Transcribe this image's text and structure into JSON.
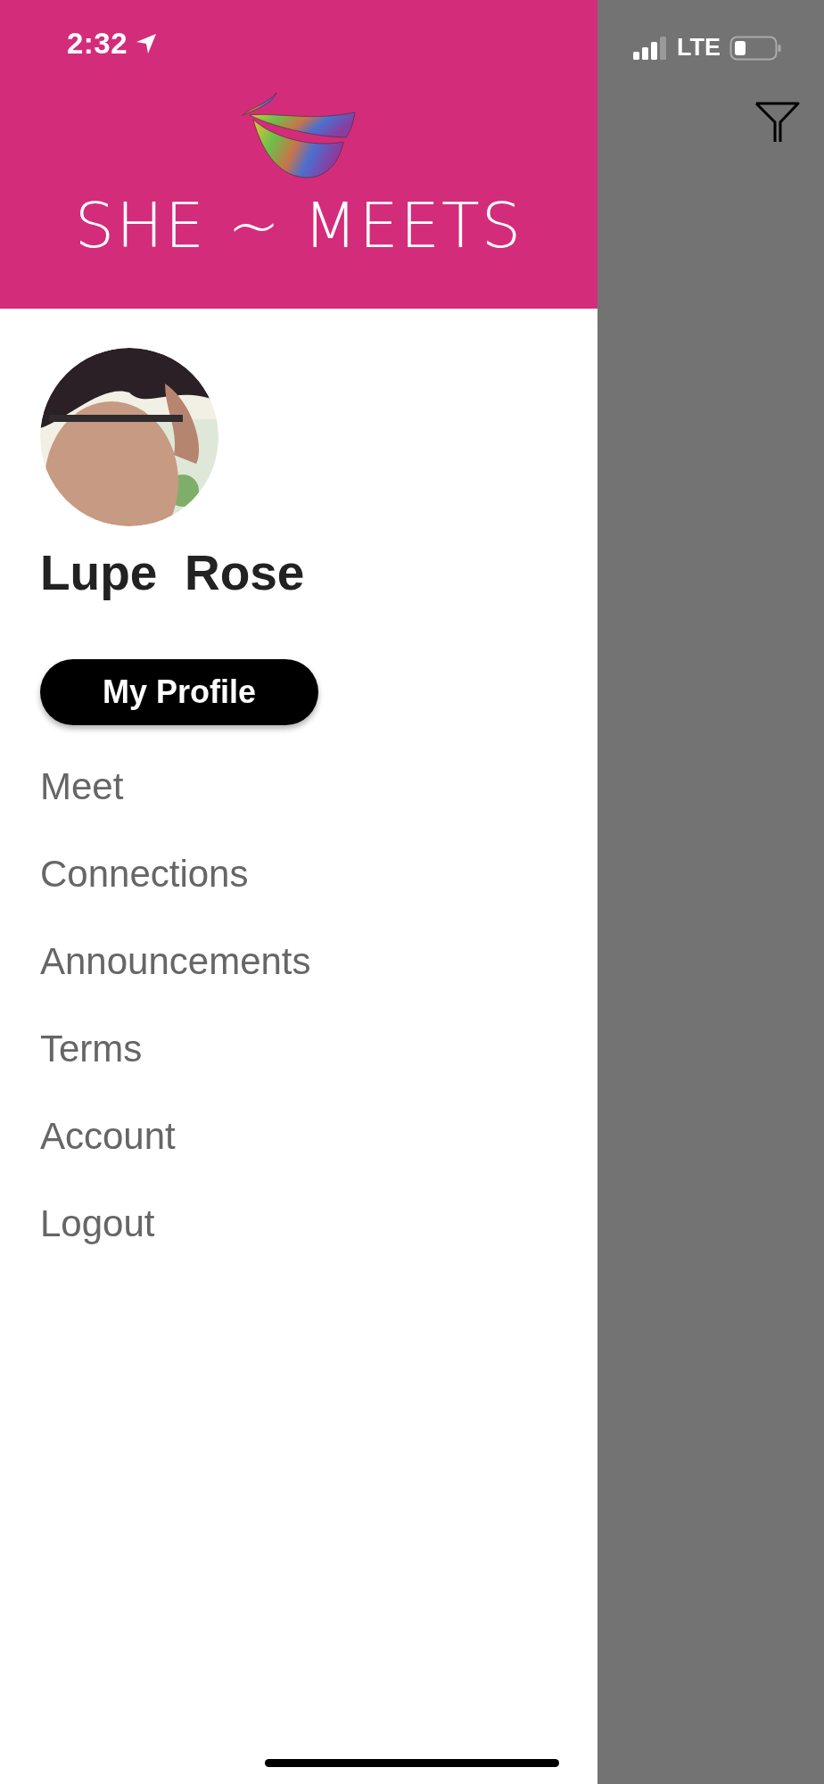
{
  "status_bar": {
    "time": "2:32",
    "network": "LTE"
  },
  "header": {
    "logo_text": "SHE ~ MEETS"
  },
  "profile": {
    "name": "Lupe  Rose",
    "button": "My Profile"
  },
  "menu": [
    {
      "label": "Meet"
    },
    {
      "label": "Connections"
    },
    {
      "label": "Announcements"
    },
    {
      "label": "Terms"
    },
    {
      "label": "Account"
    },
    {
      "label": "Logout"
    }
  ]
}
